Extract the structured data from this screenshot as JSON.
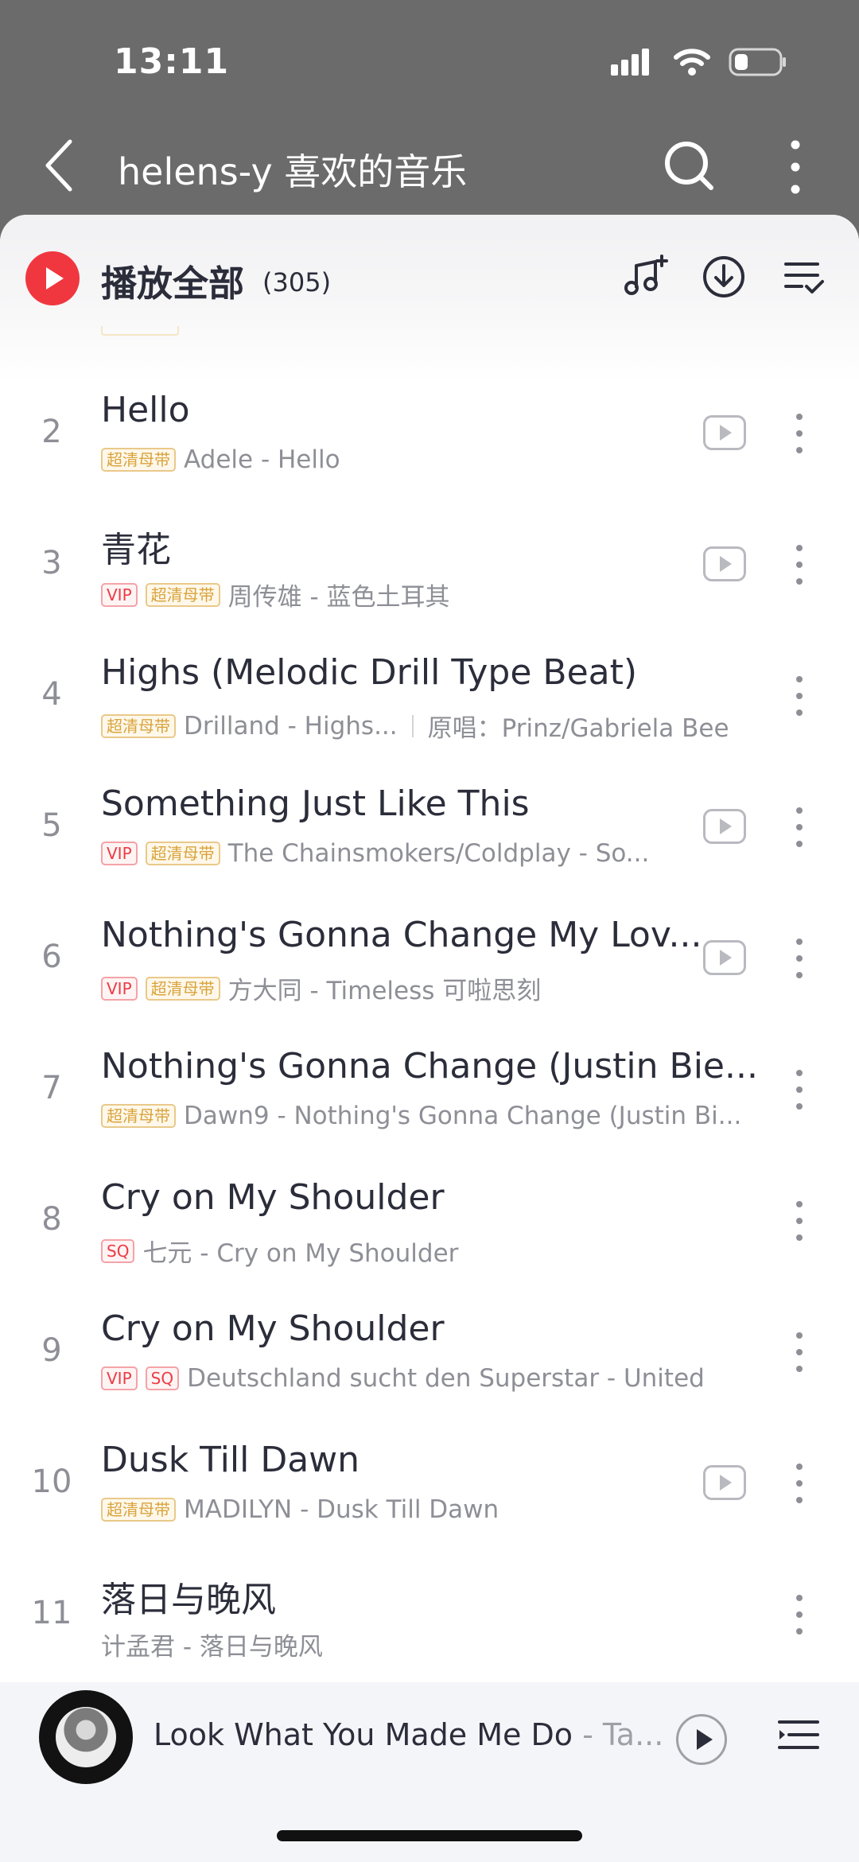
{
  "status_bar": {
    "time": "13:11"
  },
  "header": {
    "title": "helens-y 喜欢的音乐"
  },
  "play_all": {
    "label": "播放全部",
    "count": "(305)"
  },
  "songs": [
    {
      "index": "2",
      "title": "Hello",
      "badges": [
        "超清母带"
      ],
      "subtitle": "Adele - Hello",
      "cover_of": "",
      "has_mv": true
    },
    {
      "index": "3",
      "title": "青花",
      "badges": [
        "VIP",
        "超清母带"
      ],
      "subtitle": "周传雄 - 蓝色土耳其",
      "cover_of": "",
      "has_mv": true
    },
    {
      "index": "4",
      "title": "Highs (Melodic Drill Type Beat)",
      "badges": [
        "超清母带"
      ],
      "subtitle": "Drilland - Highs...",
      "cover_of": "原唱：Prinz/Gabriela Bee",
      "has_mv": false
    },
    {
      "index": "5",
      "title": "Something Just Like This",
      "badges": [
        "VIP",
        "超清母带"
      ],
      "subtitle": "The Chainsmokers/Coldplay - So...",
      "cover_of": "",
      "has_mv": true
    },
    {
      "index": "6",
      "title": "Nothing's Gonna Change My Lov...",
      "badges": [
        "VIP",
        "超清母带"
      ],
      "subtitle": "方大同 - Timeless 可啦思刻",
      "cover_of": "",
      "has_mv": true
    },
    {
      "index": "7",
      "title": "Nothing's Gonna Change (Justin Bie...",
      "badges": [
        "超清母带"
      ],
      "subtitle": "Dawn9 - Nothing's Gonna Change (Justin Bi...",
      "cover_of": "",
      "has_mv": false
    },
    {
      "index": "8",
      "title": "Cry on My Shoulder",
      "badges": [
        "SQ"
      ],
      "subtitle": "七元 - Cry on My Shoulder",
      "cover_of": "",
      "has_mv": false
    },
    {
      "index": "9",
      "title": "Cry on My Shoulder",
      "badges": [
        "VIP",
        "SQ"
      ],
      "subtitle": "Deutschland sucht den Superstar - United",
      "cover_of": "",
      "has_mv": false
    },
    {
      "index": "10",
      "title": "Dusk Till Dawn",
      "badges": [
        "超清母带"
      ],
      "subtitle": "MADILYN - Dusk Till Dawn",
      "cover_of": "",
      "has_mv": true
    },
    {
      "index": "11",
      "title": "落日与晚风",
      "badges": [],
      "subtitle": "计孟君 - 落日与晚风",
      "cover_of": "",
      "has_mv": false
    }
  ],
  "now_playing": {
    "title": "Look What You Made Me Do",
    "artist": " - Ta..."
  },
  "colors": {
    "accent_red": "#f0373f",
    "badge_gold": "#d9a33c",
    "badge_red": "#ec3c45"
  }
}
